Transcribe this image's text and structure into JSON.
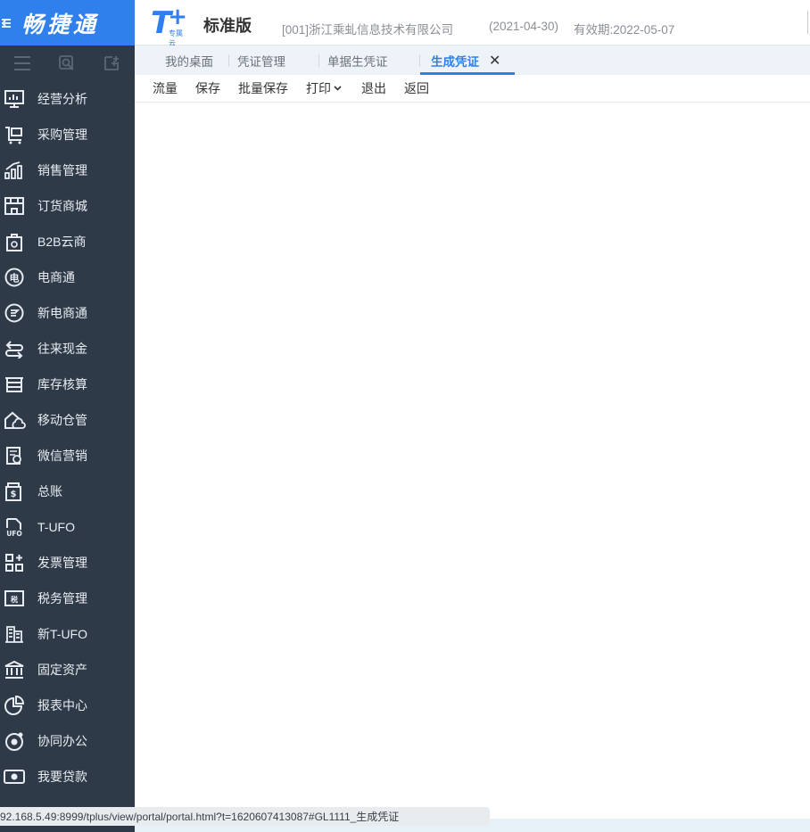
{
  "brand": {
    "name": "畅捷通"
  },
  "header": {
    "logo_sub": "专属云",
    "edition": "标准版",
    "company": "[001]浙江乘虬信息技术有限公司",
    "date": "(2021-04-30)",
    "validity": "有效期:2022-05-07"
  },
  "sidebar": {
    "tools": [
      "menu-icon",
      "search-icon",
      "add-icon"
    ],
    "items": [
      {
        "label": "经营分析",
        "icon": "monitor-icon"
      },
      {
        "label": "采购管理",
        "icon": "cart-icon"
      },
      {
        "label": "销售管理",
        "icon": "bar-chart-icon"
      },
      {
        "label": "订货商城",
        "icon": "store-icon"
      },
      {
        "label": "B2B云商",
        "icon": "bag-icon"
      },
      {
        "label": "电商通",
        "icon": "electric-icon"
      },
      {
        "label": "新电商通",
        "icon": "refresh-circle-icon"
      },
      {
        "label": "往来现金",
        "icon": "exchange-icon"
      },
      {
        "label": "库存核算",
        "icon": "warehouse-icon"
      },
      {
        "label": "移动仓管",
        "icon": "cloud-house-icon"
      },
      {
        "label": "微信营销",
        "icon": "wechat-doc-icon"
      },
      {
        "label": "总账",
        "icon": "ledger-icon"
      },
      {
        "label": "T-UFO",
        "icon": "ufo-doc-icon"
      },
      {
        "label": "发票管理",
        "icon": "grid-plus-icon"
      },
      {
        "label": "税务管理",
        "icon": "tax-icon"
      },
      {
        "label": "新T-UFO",
        "icon": "building-icon"
      },
      {
        "label": "固定资产",
        "icon": "bank-icon"
      },
      {
        "label": "报表中心",
        "icon": "pie-chart-icon"
      },
      {
        "label": "协同办公",
        "icon": "collab-icon"
      },
      {
        "label": "我要贷款",
        "icon": "money-icon"
      }
    ]
  },
  "tabs": [
    {
      "label": "我的桌面",
      "active": false
    },
    {
      "label": "凭证管理",
      "active": false
    },
    {
      "label": "单据生凭证",
      "active": false
    },
    {
      "label": "生成凭证",
      "active": true,
      "close": "✕"
    }
  ],
  "toolbar": {
    "items": [
      "流量",
      "保存",
      "批量保存",
      "打印",
      "退出",
      "返回"
    ],
    "caret": "⌄"
  },
  "statusbar": {
    "url": "92.168.5.49:8999/tplus/view/portal/portal.html?t=1620607413087#GL1111_生成凭证"
  },
  "colors": {
    "accent": "#2f80ed",
    "sidebar_bg": "#2f3a48",
    "tab_bg": "#eef3f9"
  }
}
